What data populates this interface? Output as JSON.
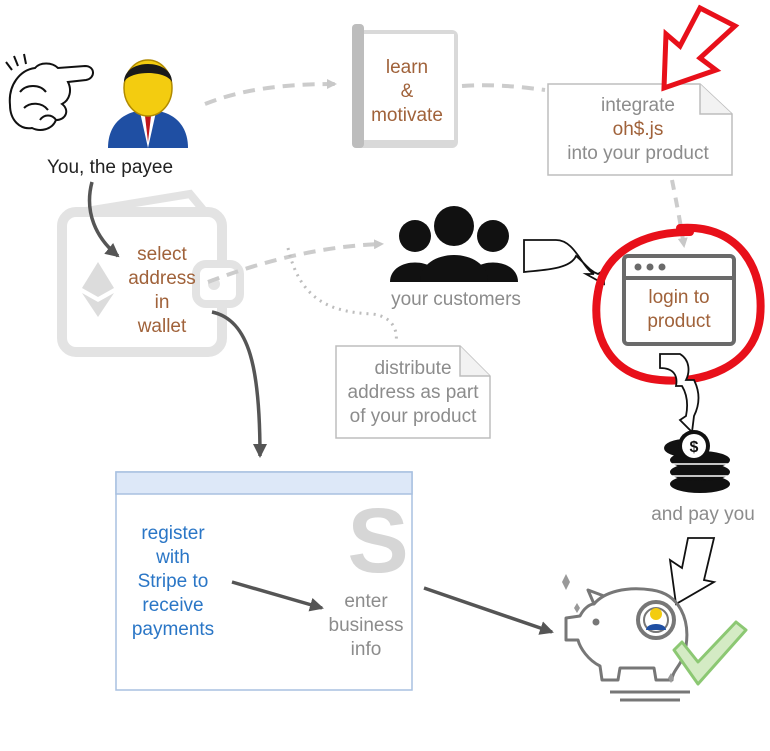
{
  "labels": {
    "payee": "You, the payee",
    "learn": "learn\n&\nmotivate",
    "integrate_line1": "integrate",
    "integrate_line2": "oh$.js",
    "integrate_line3": "into your product",
    "select_wallet": "select\naddress\nin\nwallet",
    "customers": "your customers",
    "login": "login to\nproduct",
    "distribute": "distribute\naddress as part\nof your product",
    "pay": "and pay you",
    "register": "register\nwith\nStripe to\nreceive\npayments",
    "enter_info": "enter\nbusiness\ninfo",
    "stripe_logo": "S"
  },
  "colors": {
    "brown_text": "#a0623a",
    "grey_text": "#8c8c8c",
    "blue_text": "#2a76c6",
    "highlight_red": "#e8101a",
    "success_green": "#8cc873",
    "stripe_header": "#dde8f8",
    "stripe_border": "#a8c0e0"
  },
  "icons": [
    "pointing-hand-icon",
    "user-avatar-icon",
    "book-icon",
    "note-icon",
    "red-arrow-icon",
    "wallet-icon",
    "ethereum-icon",
    "customers-icon",
    "browser-window-icon",
    "coin-stack-icon",
    "piggy-bank-icon",
    "checkmark-icon",
    "stripe-logo-icon"
  ]
}
